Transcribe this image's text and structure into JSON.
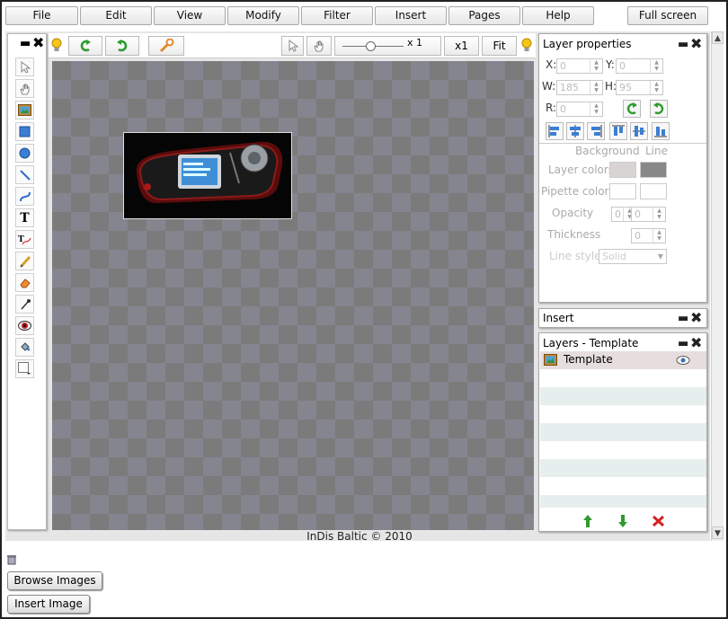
{
  "menu": {
    "items": [
      {
        "label": "File"
      },
      {
        "label": "Edit"
      },
      {
        "label": "View"
      },
      {
        "label": "Modify"
      },
      {
        "label": "Filter"
      },
      {
        "label": "Insert"
      },
      {
        "label": "Pages"
      },
      {
        "label": "Help"
      }
    ],
    "fullscreen_label": "Full screen"
  },
  "toolbar": {
    "zoom_value": "x 1",
    "x1_label": "x1",
    "fit_label": "Fit"
  },
  "layer_properties": {
    "title": "Layer properties",
    "x_label": "X:",
    "x_value": "0",
    "y_label": "Y:",
    "y_value": "0",
    "w_label": "W:",
    "w_value": "185",
    "h_label": "H:",
    "h_value": "95",
    "r_label": "R:",
    "r_value": "0",
    "background_header": "Background",
    "line_header": "Line",
    "layer_colors_label": "Layer colors",
    "pipette_colors_label": "Pipette colors",
    "opacity_label": "Opacity",
    "opacity_bg": "0",
    "opacity_line": "0",
    "thickness_label": "Thickness",
    "thickness_value": "0",
    "line_style_label": "Line style",
    "line_style_value": "Solid"
  },
  "insert_panel": {
    "title": "Insert"
  },
  "layers_panel": {
    "title": "Layers - Template",
    "layers": [
      {
        "name": "Template"
      }
    ]
  },
  "footer": {
    "copyright": "InDis Baltic © 2010"
  },
  "bottom": {
    "browse_label": "Browse Images",
    "insert_label": "Insert Image"
  },
  "colors": {
    "canvas_dark": "#7b7b7b",
    "canvas_light": "#858590",
    "selected_layer": "#e6dede",
    "delete_red": "#d62020",
    "arrow_green": "#2e9b2e"
  }
}
